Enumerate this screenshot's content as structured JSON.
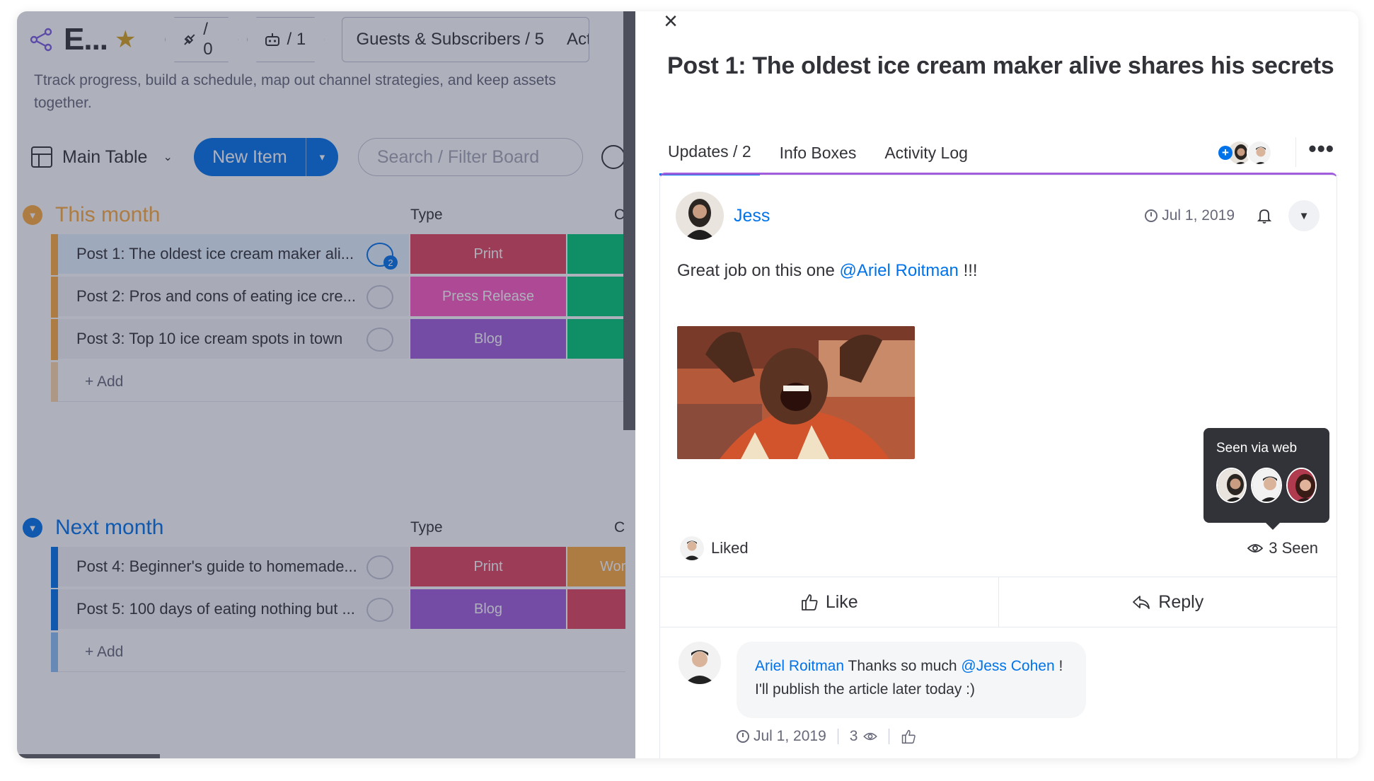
{
  "board": {
    "title": "E...",
    "integrations_label": "/ 0",
    "automations_label": "/ 1",
    "guests_label": "Guests & Subscribers / 5",
    "activity_label": "Activ",
    "description": "Ttrack progress, build a schedule, map out channel strategies, and keep assets together.",
    "view_label": "Main Table",
    "new_item_label": "New Item",
    "search_placeholder": "Search / Filter Board",
    "groups": [
      {
        "title": "This month",
        "color": "#fdab3d",
        "col_type": "Type",
        "col_c": "C",
        "rows": [
          {
            "name": "Post 1: The oldest ice cream maker ali...",
            "type": "Print",
            "type_color": "#e2445c",
            "c_color": "#00c875",
            "c_text": "",
            "updates": "2"
          },
          {
            "name": "Post 2: Pros and cons of eating ice cre...",
            "type": "Press Release",
            "type_color": "#ff5ac4",
            "c_color": "#00c875",
            "c_text": ""
          },
          {
            "name": "Post 3: Top 10 ice cream spots in town",
            "type": "Blog",
            "type_color": "#a25ddc",
            "c_color": "#00c875",
            "c_text": ""
          }
        ],
        "add_label": "+ Add"
      },
      {
        "title": "Next month",
        "color": "#0073ea",
        "col_type": "Type",
        "col_c": "C",
        "rows": [
          {
            "name": "Post 4: Beginner's guide to homemade...",
            "type": "Print",
            "type_color": "#e2445c",
            "c_color": "#fdab3d",
            "c_text": "Wor"
          },
          {
            "name": "Post 5: 100 days of eating nothing but ...",
            "type": "Blog",
            "type_color": "#a25ddc",
            "c_color": "#e2445c",
            "c_text": ""
          }
        ],
        "add_label": "+ Add"
      }
    ]
  },
  "panel": {
    "title": "Post 1: The oldest ice cream maker alive shares his secrets",
    "tabs": [
      "Updates / 2",
      "Info Boxes",
      "Activity Log"
    ],
    "update": {
      "author": "Jess",
      "date": "Jul 1, 2019",
      "body_prefix": "Great job on this one ",
      "mention": "@Ariel Roitman",
      "body_suffix": " !!!",
      "liked_label": "Liked",
      "seen_label": "3 Seen",
      "tooltip_title": "Seen via web",
      "like_label": "Like",
      "reply_label": "Reply"
    },
    "reply": {
      "author": "Ariel Roitman",
      "text_mid": " Thanks so much ",
      "mention": "@Jess Cohen",
      "text_end": " !",
      "line2": "I'll publish the article later today :)",
      "date": "Jul 1, 2019",
      "views": "3"
    }
  },
  "colors": {
    "primary": "#0073ea",
    "accent_purple": "#a25ddc",
    "star": "#d9a41e"
  },
  "icons": [
    "share-icon",
    "star-icon",
    "integrations-icon",
    "automations-icon",
    "table-icon",
    "chevron-down-icon",
    "person-icon",
    "close-icon",
    "more-icon",
    "clock-icon",
    "bell-icon",
    "eye-icon",
    "thumbs-up-icon",
    "reply-icon",
    "updates-bubble-icon"
  ]
}
